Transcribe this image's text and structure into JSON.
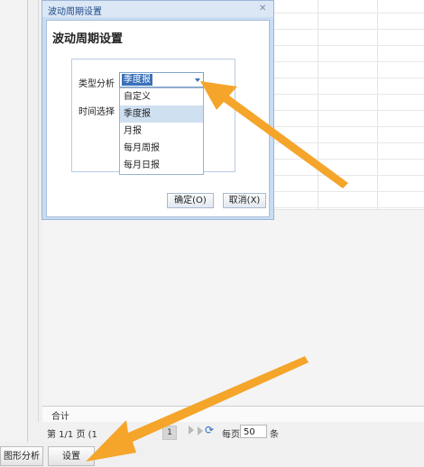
{
  "dialog": {
    "title": "波动周期设置",
    "heading": "波动周期设置",
    "type_label": "类型分析",
    "time_label": "时间选择",
    "type_selected": "季度报",
    "options": [
      "自定义",
      "季度报",
      "月报",
      "每月周报",
      "每月日报"
    ],
    "selected_index": 1,
    "ok_label": "确定(O)",
    "cancel_label": "取消(X)"
  },
  "grid": {
    "total_label": "合计"
  },
  "pager": {
    "page_info": "第 1/1 页 (1",
    "current_page": "1",
    "per_page_label": "每页",
    "per_page_value": "50",
    "unit_label": "条"
  },
  "bottom_tabs": {
    "chart_analysis": "图形分析",
    "settings": "设置"
  },
  "colors": {
    "accent_arrow": "#f4a52a",
    "selection": "#3a70b8"
  },
  "icons": {
    "close": "close-icon",
    "dropdown": "chevron-down-icon",
    "next_page": "next-page-icon",
    "last_page": "last-page-icon",
    "refresh": "refresh-icon"
  }
}
